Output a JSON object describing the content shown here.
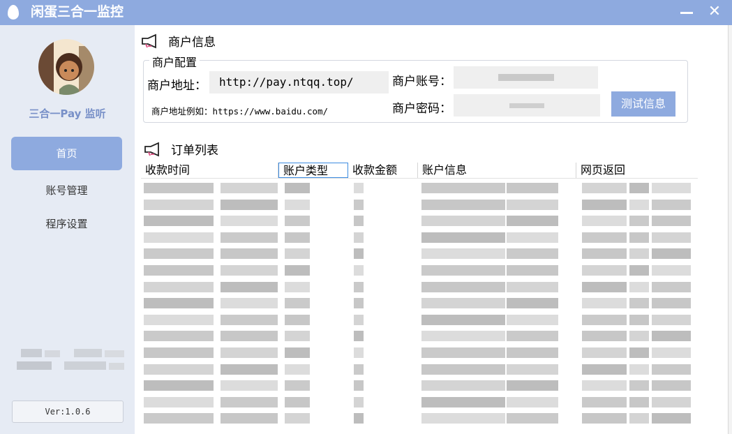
{
  "window": {
    "title": "闲蛋三合一监控",
    "minimize_label": "—",
    "close_label": "✕"
  },
  "sidebar": {
    "brand": "三合一Pay 监听",
    "items": [
      {
        "label": "首页",
        "active": true
      },
      {
        "label": "账号管理",
        "active": false
      },
      {
        "label": "程序设置",
        "active": false
      }
    ],
    "version": "Ver:1.0.6"
  },
  "merchant": {
    "section_title": "商户信息",
    "group_title": "商户配置",
    "address_label": "商户地址：",
    "address_value": "http://pay.ntqq.top/",
    "address_hint": "商户地址例如：https://www.baidu.com/",
    "account_label": "商户账号：",
    "password_label": "商户密码：",
    "test_button": "测试信息"
  },
  "orders": {
    "section_title": "订单列表",
    "columns": [
      "收款时间",
      "账户类型",
      "收款金额",
      "账户信息",
      "网页返回"
    ],
    "selected_column": "账户类型",
    "row_count": 15
  },
  "colors": {
    "accent": "#8eaadf",
    "sidebar_bg": "#e6ebf4",
    "brand_text": "#7890c8"
  }
}
